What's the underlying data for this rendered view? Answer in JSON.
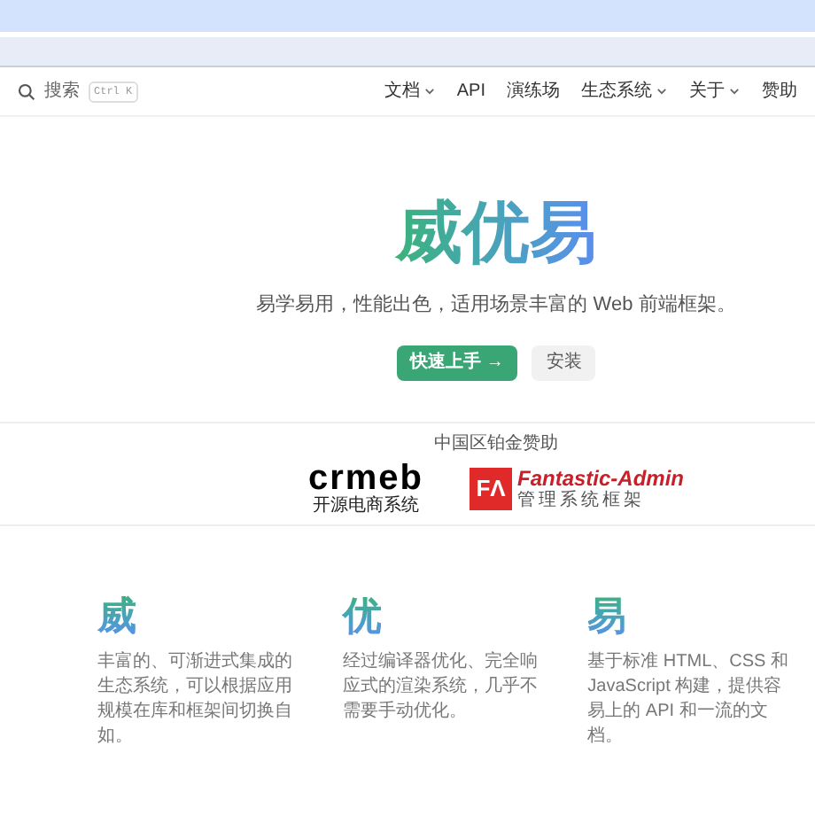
{
  "nav": {
    "search_label": "搜索",
    "shortcut": "Ctrl K",
    "links": [
      {
        "label": "文档",
        "dropdown": true
      },
      {
        "label": "API",
        "dropdown": false
      },
      {
        "label": "演练场",
        "dropdown": false
      },
      {
        "label": "生态系统",
        "dropdown": true
      },
      {
        "label": "关于",
        "dropdown": true
      },
      {
        "label": "赞助",
        "dropdown": false
      }
    ]
  },
  "hero": {
    "title": "威优易",
    "tagline": "易学易用，性能出色，适用场景丰富的 Web 前端框架。",
    "buttons": [
      {
        "label": "快速上手 →",
        "kind": "primary"
      },
      {
        "label": "安装",
        "kind": "secondary"
      }
    ]
  },
  "sponsors": {
    "heading": "中国区铂金赞助",
    "items": [
      {
        "kind": "crmeb",
        "name": "crmeb",
        "subtitle": "开源电商系统"
      },
      {
        "kind": "fantastic",
        "mark": "FΛ",
        "name": "Fantastic-Admin",
        "subtitle": "管理系统框架"
      }
    ]
  },
  "features": [
    {
      "title": "威",
      "text": "丰富的、可渐进式集成的生态系统，可以根据应用规模在库和框架间切换自如。"
    },
    {
      "title": "优",
      "text": "经过编译器优化、完全响应式的渲染系统，几乎不需要手动优化。"
    },
    {
      "title": "易",
      "text": "基于标准 HTML、CSS 和 JavaScript 构建，提供容易上的 API 和一流的文档。"
    }
  ]
}
